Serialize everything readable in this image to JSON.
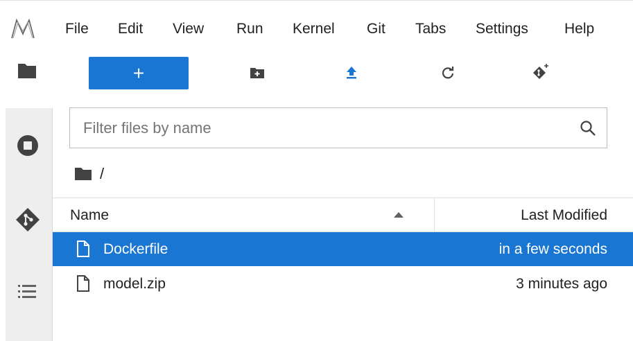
{
  "menu": {
    "items": [
      "File",
      "Edit",
      "View",
      "Run",
      "Kernel",
      "Git",
      "Tabs",
      "Settings",
      "Help"
    ]
  },
  "toolbar": {
    "new_label": "+",
    "icons": [
      "new-folder-icon",
      "upload-icon",
      "refresh-icon",
      "git-clone-icon"
    ]
  },
  "activity_bar": {
    "icons": [
      "folder-icon",
      "running-stop-icon",
      "git-icon",
      "table-of-contents-icon"
    ]
  },
  "filter": {
    "placeholder": "Filter files by name",
    "value": ""
  },
  "breadcrumb": {
    "path": "/"
  },
  "listing": {
    "columns": [
      "Name",
      "Last Modified"
    ],
    "sort": "ascending",
    "rows": [
      {
        "name": "Dockerfile",
        "modified": "in a few seconds",
        "selected": true
      },
      {
        "name": "model.zip",
        "modified": "3 minutes ago",
        "selected": false
      }
    ]
  },
  "colors": {
    "accent": "#1976d2",
    "icon": "#424242",
    "activity_bg": "#eeeeee"
  }
}
